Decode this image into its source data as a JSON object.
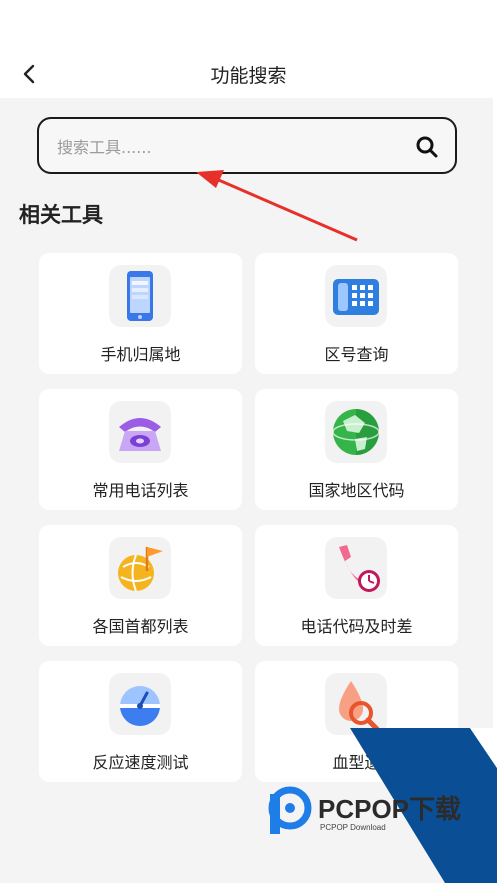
{
  "header": {
    "title": "功能搜索",
    "back_icon": "chevron-left-icon"
  },
  "search": {
    "placeholder": "搜索工具......",
    "icon": "search-icon"
  },
  "section": {
    "title": "相关工具"
  },
  "tools": [
    {
      "label": "手机归属地",
      "icon": "mobile-phone-icon"
    },
    {
      "label": "区号查询",
      "icon": "desk-phone-icon"
    },
    {
      "label": "常用电话列表",
      "icon": "rotary-phone-icon"
    },
    {
      "label": "国家地区代码",
      "icon": "globe-icon"
    },
    {
      "label": "各国首都列表",
      "icon": "globe-flag-icon"
    },
    {
      "label": "电话代码及时差",
      "icon": "phone-clock-icon"
    },
    {
      "label": "反应速度测试",
      "icon": "speed-gauge-icon"
    },
    {
      "label": "血型遗",
      "icon": "blood-search-icon"
    }
  ],
  "watermark": {
    "text": "PCPOP下载",
    "subtext": "PCPOP Download"
  },
  "colors": {
    "accent_red": "#e8302a",
    "watermark_blue": "#0a4f96"
  }
}
